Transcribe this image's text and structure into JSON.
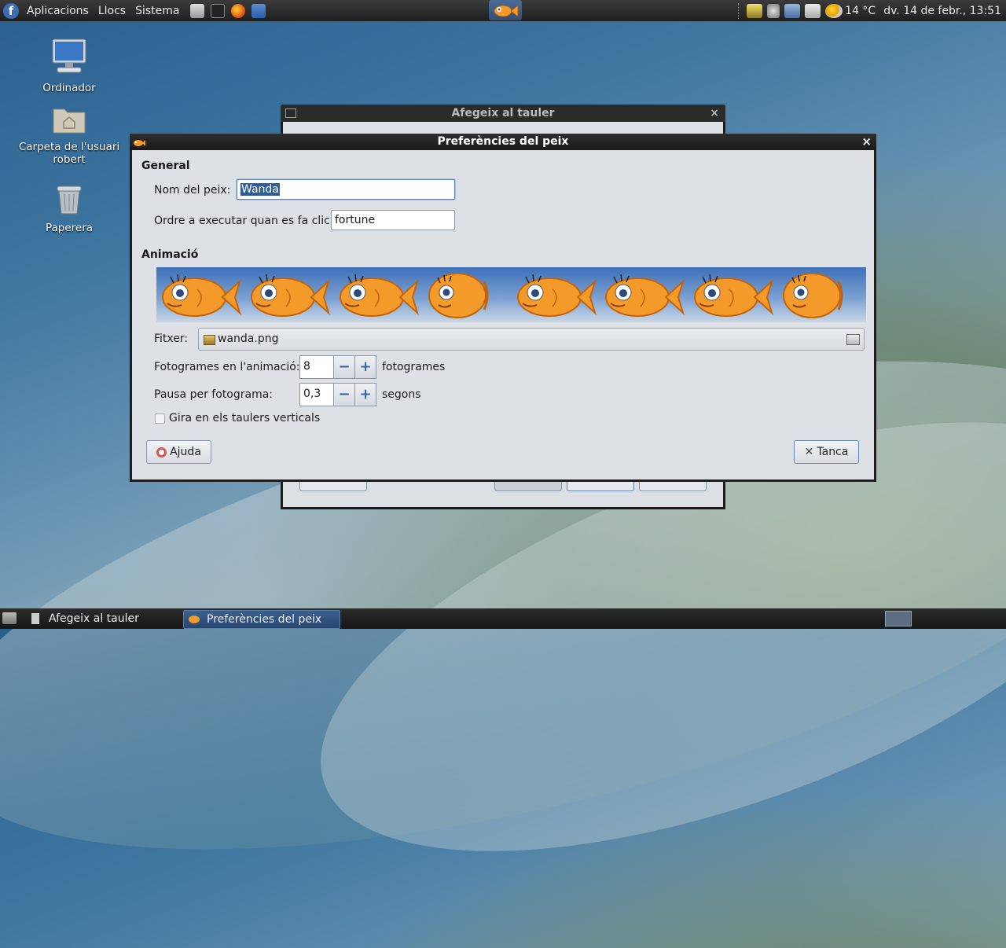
{
  "top_panel": {
    "menus": [
      "Aplicacions",
      "Llocs",
      "Sistema"
    ],
    "temperature": "14 °C",
    "clock": "dv. 14 de febr., 13:51",
    "icons": [
      "fedora-icon",
      "file-manager-icon",
      "terminal-icon",
      "firefox-icon",
      "mail-icon",
      "fish-applet-icon",
      "display-icon",
      "volume-icon",
      "network-icon",
      "printer-icon",
      "weather-icon"
    ]
  },
  "desktop": {
    "icons": [
      {
        "label": "Ordinador",
        "icon": "computer-icon"
      },
      {
        "label": "Carpeta de l'usuari robert",
        "icon": "home-folder-icon"
      },
      {
        "label": "Paperera",
        "icon": "trash-icon"
      }
    ]
  },
  "background_window": {
    "title": "Afegeix al tauler"
  },
  "dialog": {
    "title": "Preferències del peix",
    "general_heading": "General",
    "fish_name_label": "Nom del peix:",
    "fish_name_value": "Wanda",
    "command_label": "Ordre a executar quan es fa clic:",
    "command_value": "fortune",
    "animation_heading": "Animació",
    "animation_frames": 8,
    "file_label": "Fitxer:",
    "file_value": "wanda.png",
    "frames_label": "Fotogrames en l'animació:",
    "frames_value": "8",
    "frames_unit": "fotogrames",
    "pause_label": "Pausa per fotograma:",
    "pause_value": "0,3",
    "pause_unit": "segons",
    "rotate_label": "Gira en els taulers verticals",
    "rotate_checked": false,
    "help_button": "Ajuda",
    "close_button": "Tanca"
  },
  "taskbar": {
    "tasks": [
      {
        "label": "Afegeix al tauler",
        "active": false
      },
      {
        "label": "Preferències del peix",
        "active": true
      }
    ]
  },
  "colors": {
    "accent": "#2e5d9a",
    "fish": "#f39a2b"
  }
}
